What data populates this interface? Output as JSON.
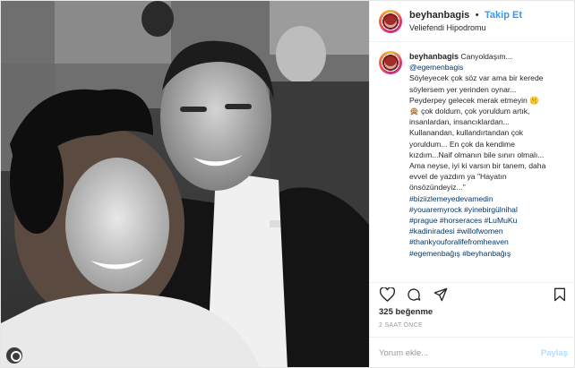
{
  "header": {
    "username": "beyhanbagis",
    "separator": "•",
    "follow_label": "Takip Et",
    "location": "Veliefendi Hipodromu"
  },
  "caption": {
    "username": "beyhanbagis",
    "lines": [
      "Canyoldaşım...",
      "@egemenbagis",
      "Söyleyecek çok söz var ama bir kerede",
      "söylersem yer yerinden oynar...",
      "Peyderpey gelecek merak etmeyin 🤫",
      "🙊 çok doldum, çok yoruldum artık,",
      "insanlardan, insancıklardan...",
      "Kullanandan, kullandırtandan çok",
      "yoruldum... En çok da kendime",
      "kızdım...Naif olmanın bile sınırı olmalı...",
      "Ama neyse, iyi ki varsın bir tanem, daha",
      "evvel de yazdım ya \"Hayatın",
      "önsözündeyiz...\""
    ],
    "hashtags": [
      "#biziizlemeyedevamedin",
      "#youaremyrock #yinebirgülnihal",
      "#prague #horseraces #LuMuKu",
      "#kadiniradesi #willofwomen",
      "#thankyouforalifefromheaven",
      "#egemenbağış #beyhanbağış"
    ]
  },
  "actions": {
    "like_icon": "heart-icon",
    "comment_icon": "comment-icon",
    "share_icon": "share-icon",
    "save_icon": "bookmark-icon"
  },
  "likes_text": "325 beğenme",
  "timestamp": "2 SAAT ÖNCE",
  "comment": {
    "placeholder": "Yorum ekle...",
    "post_label": "Paylaş"
  },
  "colors": {
    "link_blue": "#3897f0",
    "hashtag": "#003569",
    "post_disabled": "#b3dbff"
  }
}
